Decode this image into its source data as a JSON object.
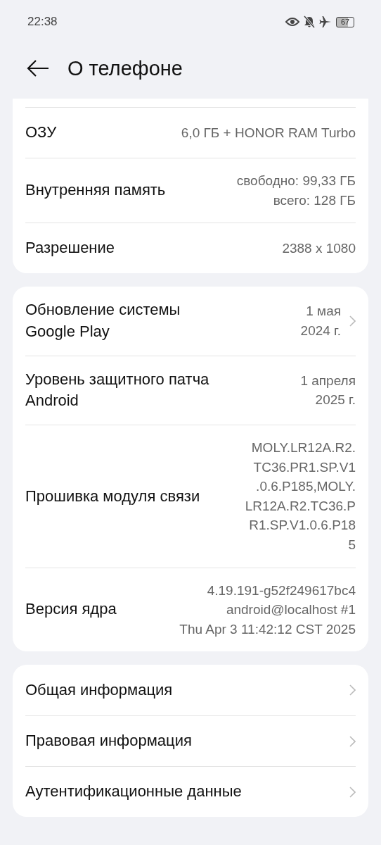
{
  "status_bar": {
    "time": "22:38",
    "battery": "67"
  },
  "header": {
    "title": "О телефоне"
  },
  "groups": [
    {
      "cut_top": true,
      "rows": [
        {
          "label": "ОЗУ",
          "value": "6,0  ГБ + HONOR RAM Turbo",
          "chevron": false
        },
        {
          "label": "Внутренняя память",
          "value": "свободно: 99,33  ГБ\nвсего: 128  ГБ",
          "chevron": false
        },
        {
          "label": "Разрешение",
          "value": "2388 x 1080",
          "chevron": false
        }
      ]
    },
    {
      "cut_top": false,
      "rows": [
        {
          "label": "Обновление системы\nGoogle Play",
          "value": "1 мая\n2024 г.",
          "chevron": true
        },
        {
          "label": "Уровень защитного патча\nAndroid",
          "value": "1 апреля\n2025 г.",
          "chevron": false
        },
        {
          "label": "Прошивка модуля связи",
          "value": "MOLY.LR12A.R2.\nTC36.PR1.SP.V1\n.0.6.P185,MOLY.\nLR12A.R2.TC36.P\nR1.SP.V1.0.6.P18\n5",
          "chevron": false
        },
        {
          "label": "Версия ядра",
          "value": "4.19.191-g52f249617bc4\nandroid@localhost #1\nThu Apr 3 11:42:12 CST 2025",
          "chevron": false
        }
      ]
    },
    {
      "cut_top": false,
      "rows": [
        {
          "label": "Общая информация",
          "chevron": true
        },
        {
          "label": "Правовая информация",
          "chevron": true
        },
        {
          "label": "Аутентификационные данные",
          "chevron": true
        }
      ]
    }
  ]
}
